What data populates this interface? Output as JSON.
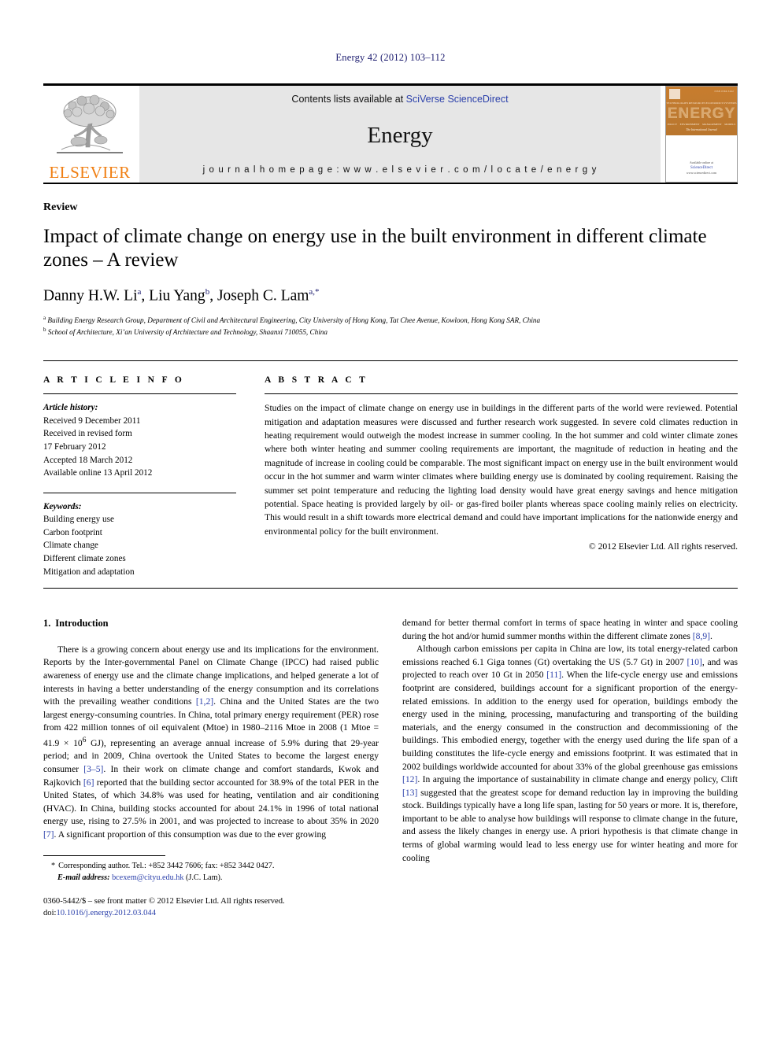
{
  "running_head": "Energy 42 (2012) 103–112",
  "masthead": {
    "publisher_name": "ELSEVIER",
    "contents_prefix": "Contents lists available at ",
    "contents_link": "SciVerse ScienceDirect",
    "journal_title": "Energy",
    "homepage": "j o u r n a l   h o m e p a g e :   w w w . e l s e v i e r . c o m / l o c a t e / e n e r g y",
    "cover": {
      "title": "ENERGY",
      "tagline": "The International Journal",
      "issn_corner": "ISSN 0360-5442",
      "subhead_top": [
        "TECHNOLOGIES",
        "RESOURCES",
        "ECONOMICS",
        "SYSTEMS"
      ],
      "subhead_bottom": [
        "POLICY",
        "ENVIRONMENT",
        "MANAGEMENT",
        "MODELS"
      ],
      "availability": "Available online at",
      "availability_main": "ScienceDirect",
      "availability_url": "www.sciencedirect.com"
    }
  },
  "article": {
    "doctype": "Review",
    "title": "Impact of climate change on energy use in the built environment in different climate zones – A review",
    "authors": [
      {
        "name": "Danny H.W. Li",
        "marks": "a"
      },
      {
        "name": "Liu Yang",
        "marks": "b"
      },
      {
        "name": "Joseph C. Lam",
        "marks": "a,*"
      }
    ],
    "authors_line": "Danny H.W. Li a, Liu Yang b, Joseph C. Lam a,*",
    "affiliations": [
      {
        "mark": "a",
        "text": "Building Energy Research Group, Department of Civil and Architectural Engineering, City University of Hong Kong, Tat Chee Avenue, Kowloon, Hong Kong SAR, China"
      },
      {
        "mark": "b",
        "text": "School of Architecture, Xi’an University of Architecture and Technology, Shaanxi 710055, China"
      }
    ]
  },
  "info": {
    "heading": "A R T I C L E  I N F O",
    "history_label": "Article history:",
    "history": [
      "Received 9 December 2011",
      "Received in revised form",
      "17 February 2012",
      "Accepted 18 March 2012",
      "Available online 13 April 2012"
    ],
    "keywords_label": "Keywords:",
    "keywords": [
      "Building energy use",
      "Carbon footprint",
      "Climate change",
      "Different climate zones",
      "Mitigation and adaptation"
    ]
  },
  "abstract": {
    "heading": "A B S T R A C T",
    "text": "Studies on the impact of climate change on energy use in buildings in the different parts of the world were reviewed. Potential mitigation and adaptation measures were discussed and further research work suggested. In severe cold climates reduction in heating requirement would outweigh the modest increase in summer cooling. In the hot summer and cold winter climate zones where both winter heating and summer cooling requirements are important, the magnitude of reduction in heating and the magnitude of increase in cooling could be comparable. The most significant impact on energy use in the built environment would occur in the hot summer and warm winter climates where building energy use is dominated by cooling requirement. Raising the summer set point temperature and reducing the lighting load density would have great energy savings and hence mitigation potential. Space heating is provided largely by oil- or gas-fired boiler plants whereas space cooling mainly relies on electricity. This would result in a shift towards more electrical demand and could have important implications for the nationwide energy and environmental policy for the built environment.",
    "copyright": "© 2012 Elsevier Ltd. All rights reserved."
  },
  "sections": {
    "intro_number": "1.",
    "intro_title": "Introduction"
  },
  "body": {
    "left_paragraph_1_a": "There is a growing concern about energy use and its implications for the environment. Reports by the Inter-governmental Panel on Climate Change (IPCC) had raised public awareness of energy use and the climate change implications, and helped generate a lot of interests in having a better understanding of the energy consumption and its correlations with the prevailing weather conditions ",
    "ref_1_2": "[1,2]",
    "left_paragraph_1_b": ". China and the United States are the two largest energy-consuming countries. In China, total primary energy requirement (PER) rose from 422 million tonnes of oil equivalent (Mtoe) in 1980–2116 Mtoe in 2008 (1 Mtoe = 41.9 × 10",
    "exp_6": "6",
    "left_paragraph_1_c": " GJ), representing an average annual increase of 5.9% during that 29-year period; and in 2009, China overtook the United States to become the largest energy consumer ",
    "ref_3_5": "[3–5]",
    "left_paragraph_1_d": ". In their work on climate change and comfort standards, Kwok and Rajkovich ",
    "ref_6": "[6]",
    "left_paragraph_1_e": " reported that the building sector accounted for 38.9% of the total PER in the United States, of which 34.8% was used for heating, ventilation and air conditioning (HVAC). In China, building stocks accounted for about 24.1% in 1996 of total national energy use, rising to 27.5% in 2001, and was projected to increase to about 35% in 2020 ",
    "ref_7": "[7]",
    "left_paragraph_1_f": ". A significant proportion of this consumption was due to the ever growing",
    "right_paragraph_1_a": "demand for better thermal comfort in terms of space heating in winter and space cooling during the hot and/or humid summer months within the different climate zones ",
    "ref_8_9": "[8,9]",
    "right_paragraph_1_b": ".",
    "right_paragraph_2_a": "Although carbon emissions per capita in China are low, its total energy-related carbon emissions reached 6.1 Giga tonnes (Gt) overtaking the US (5.7 Gt) in 2007 ",
    "ref_10": "[10]",
    "right_paragraph_2_b": ", and was projected to reach over 10 Gt in 2050 ",
    "ref_11": "[11]",
    "right_paragraph_2_c": ". When the life-cycle energy use and emissions footprint are considered, buildings account for a significant proportion of the energy-related emissions. In addition to the energy used for operation, buildings embody the energy used in the mining, processing, manufacturing and transporting of the building materials, and the energy consumed in the construction and decommissioning of the buildings. This embodied energy, together with the energy used during the life span of a building constitutes the life-cycle energy and emissions footprint. It was estimated that in 2002 buildings worldwide accounted for about 33% of the global greenhouse gas emissions ",
    "ref_12": "[12]",
    "right_paragraph_2_d": ". In arguing the importance of sustainability in climate change and energy policy, Clift ",
    "ref_13": "[13]",
    "right_paragraph_2_e": " suggested that the greatest scope for demand reduction lay in improving the building stock. Buildings typically have a long life span, lasting for 50 years or more. It is, therefore, important to be able to analyse how buildings will response to climate change in the future, and assess the likely changes in energy use. A priori hypothesis is that climate change in terms of global warming would lead to less energy use for winter heating and more for cooling"
  },
  "footer": {
    "star": "*",
    "corresponding": "Corresponding author. Tel.: +852 3442 7606; fax: +852 3442 0427.",
    "email_label": "E-mail address:",
    "email": "bcexem@cityu.edu.hk",
    "email_owner": "(J.C. Lam).",
    "issn_line": "0360-5442/$ – see front matter © 2012 Elsevier Ltd. All rights reserved.",
    "doi_label": "doi:",
    "doi": "10.1016/j.energy.2012.03.044"
  },
  "colors": {
    "link": "#2a3faa",
    "runhead": "#1a1a6e",
    "elsevier_orange": "#f07f13",
    "banner_bg": "#e6e6e6",
    "cover_orange": "#bf7a30"
  }
}
